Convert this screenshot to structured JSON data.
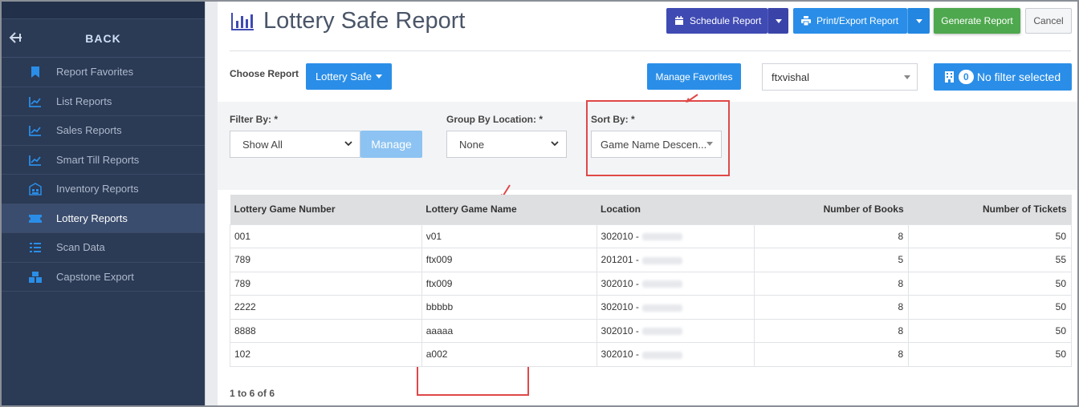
{
  "sidebar": {
    "back_label": "BACK",
    "items": [
      {
        "label": "Report Favorites",
        "icon": "bookmark-icon",
        "active": false
      },
      {
        "label": "List Reports",
        "icon": "chart-line-icon",
        "active": false
      },
      {
        "label": "Sales Reports",
        "icon": "chart-line-icon",
        "active": false
      },
      {
        "label": "Smart Till Reports",
        "icon": "chart-line-icon",
        "active": false
      },
      {
        "label": "Inventory Reports",
        "icon": "warehouse-icon",
        "active": false
      },
      {
        "label": "Lottery Reports",
        "icon": "ticket-icon",
        "active": true
      },
      {
        "label": "Scan Data",
        "icon": "list-icon",
        "active": false
      },
      {
        "label": "Capstone Export",
        "icon": "boxes-icon",
        "active": false
      }
    ]
  },
  "header": {
    "title": "Lottery Safe Report",
    "schedule_label": "Schedule Report",
    "print_label": "Print/Export Report",
    "generate_label": "Generate Report",
    "cancel_label": "Cancel"
  },
  "controls": {
    "choose_label": "Choose Report",
    "report_dropdown": "Lottery Safe",
    "manage_favorites_label": "Manage Favorites",
    "user_value": "ftxvishal",
    "filter_count": "0",
    "filter_text": "No filter selected"
  },
  "filters": {
    "filter_by_label": "Filter By: *",
    "filter_by_value": "Show All",
    "manage_label": "Manage",
    "group_by_label": "Group By Location: *",
    "group_by_value": "None",
    "sort_by_label": "Sort By: *",
    "sort_by_value": "Game Name Descen..."
  },
  "table": {
    "headers": [
      "Lottery Game Number",
      "Lottery Game Name",
      "Location",
      "Number of Books",
      "Number of Tickets"
    ],
    "rows": [
      [
        "001",
        "v01",
        "302010 -",
        "8",
        "50"
      ],
      [
        "789",
        "ftx009",
        "201201 -",
        "5",
        "55"
      ],
      [
        "789",
        "ftx009",
        "302010 -",
        "8",
        "50"
      ],
      [
        "2222",
        "bbbbb",
        "302010 -",
        "8",
        "50"
      ],
      [
        "8888",
        "aaaaa",
        "302010 -",
        "8",
        "50"
      ],
      [
        "102",
        "a002",
        "302010 -",
        "8",
        "50"
      ]
    ]
  },
  "pager": "1 to 6 of 6",
  "colors": {
    "sidebar_bg": "#2b3a55",
    "primary": "#2a8ee8",
    "schedule": "#3f4ab3",
    "generate": "#4ea84e",
    "highlight": "#e04848"
  }
}
